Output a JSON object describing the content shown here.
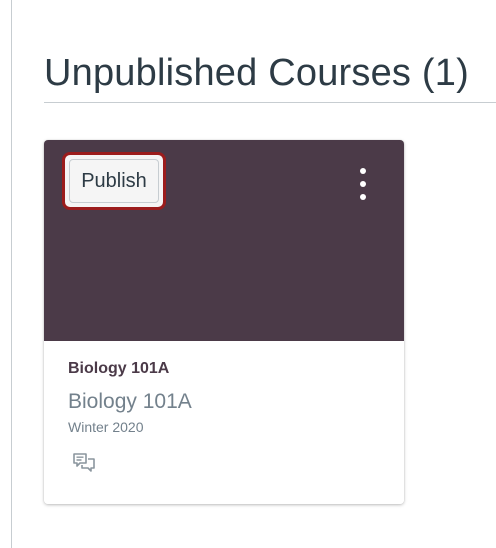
{
  "section": {
    "heading": "Unpublished Courses (1)"
  },
  "course_card": {
    "publish_label": "Publish",
    "title": "Biology 101A",
    "code": "Biology 101A",
    "term": "Winter 2020",
    "hero_color": "#4b3a48",
    "highlight_color": "#9b1c1c",
    "icons": {
      "menu": "kebab-menu-icon",
      "discussions": "discussions-icon"
    }
  }
}
